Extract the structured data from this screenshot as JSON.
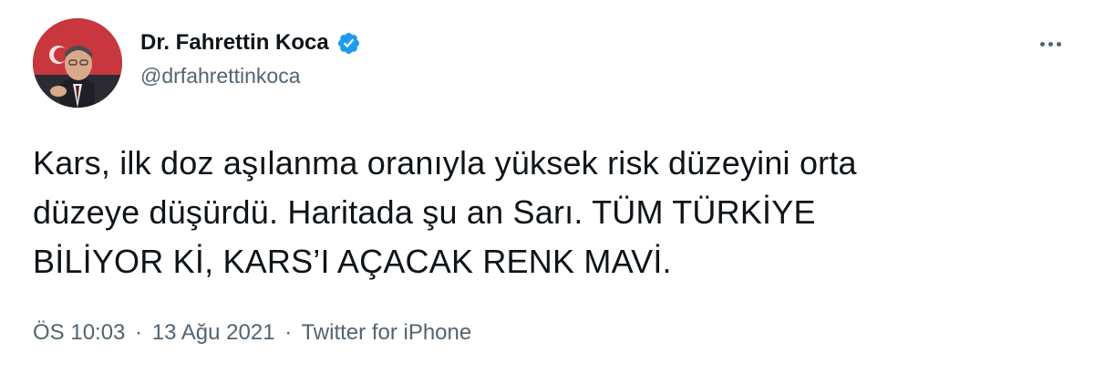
{
  "author": {
    "name": "Dr. Fahrettin Koca",
    "handle": "@drfahrettinkoca",
    "verified": true
  },
  "tweet": {
    "lines": [
      "Kars, ilk doz aşılanma oranıyla yüksek risk düzeyini orta",
      "düzeye düşürdü. Haritada şu an Sarı. TÜM TÜRKİYE",
      "BİLİYOR Kİ, KARS’I AÇACAK RENK MAVİ."
    ]
  },
  "meta": {
    "time": "ÖS 10:03",
    "separator": "·",
    "date": "13 Ağu 2021",
    "source": "Twitter for iPhone"
  },
  "icons": {
    "verified": "verified-badge-icon",
    "more": "more-options-icon"
  },
  "colors": {
    "text": "#0f1419",
    "secondary": "#536471",
    "verified": "#1d9bf0"
  }
}
